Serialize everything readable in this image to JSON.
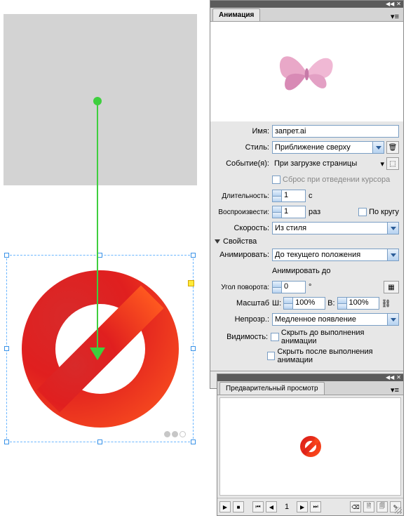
{
  "panel": {
    "tab": "Анимация",
    "name_label": "Имя:",
    "name_value": "запрет.ai",
    "style_label": "Стиль:",
    "style_value": "Приближение сверху",
    "event_label": "Событие(я):",
    "event_value": "При загрузке страницы",
    "reset_label": "Сброс при отведении курсора",
    "duration_label": "Длительность:",
    "duration_value": "1",
    "duration_unit": "с",
    "play_label": "Воспроизвести:",
    "play_value": "1",
    "play_unit": "раз",
    "loop_label": "По кругу",
    "speed_label": "Скорость:",
    "speed_value": "Из стиля",
    "props_section": "Свойства",
    "animate_label": "Анимировать:",
    "animate_value": "До текущего положения",
    "animate_to": "Анимировать до",
    "rotate_label": "Угол поворота:",
    "rotate_value": "0",
    "rotate_unit": "°",
    "scale_label": "Масштаб",
    "scale_w": "Ш:",
    "scale_w_val": "100%",
    "scale_h": "В:",
    "scale_h_val": "100%",
    "opacity_label": "Непрозр.:",
    "opacity_value": "Медленное появление",
    "visibility_label": "Видимость:",
    "hide_before": "Скрыть до выполнения анимации",
    "hide_after": "Скрыть после выполнения анимации"
  },
  "preview": {
    "tab": "Предварительный просмотр",
    "frame": "1"
  }
}
